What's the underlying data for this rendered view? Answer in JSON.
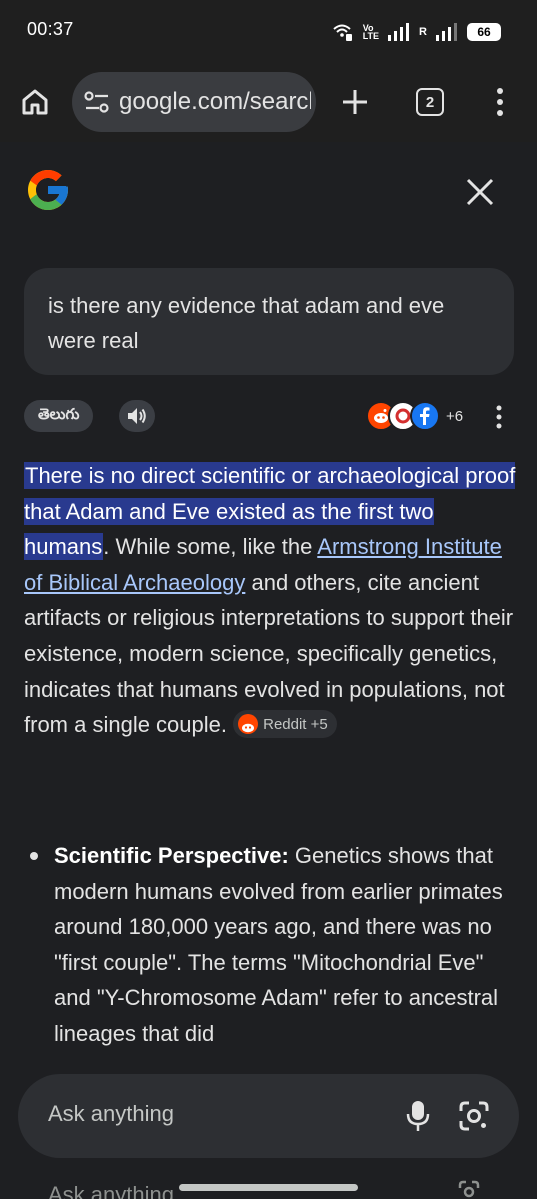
{
  "status_bar": {
    "time": "00:37",
    "volte_top": "Vo",
    "volte_bottom": "LTE",
    "roaming": "R",
    "battery": "66"
  },
  "toolbar": {
    "url": "google.com/search"
  },
  "tabs_count": "2",
  "query": {
    "text": "is there any evidence that adam and eve were real"
  },
  "controls": {
    "language_chip": "తెలుగు",
    "sources_more": "+6"
  },
  "answer": {
    "highlight": "There is no direct scientific or archaeological proof that Adam and Eve existed as the first two humans",
    "after_highlight": ". While some, like the ",
    "link_text": "Armstrong Institute of Biblical Archaeology",
    "rest": " and others, cite ancient artifacts or religious interpretations to support their existence, modern science, specifically genetics, indicates that humans evolved in populations, not from a single couple. ",
    "citation": "Reddit +5"
  },
  "bullets": [
    {
      "title": "Scientific Perspective:",
      "text": " Genetics shows that modern humans evolved from earlier primates around 180,000 years ago, and there was no \"first couple\". The terms \"Mitochondrial Eve\" and \"Y-Chromosome Adam\" refer to ancestral lineages that did"
    }
  ],
  "ask": {
    "placeholder": "Ask anything"
  },
  "colors": {
    "background": "#1e1f22",
    "highlight": "#293a8f",
    "link": "#a8c7fa",
    "chip": "#2d2f33"
  }
}
